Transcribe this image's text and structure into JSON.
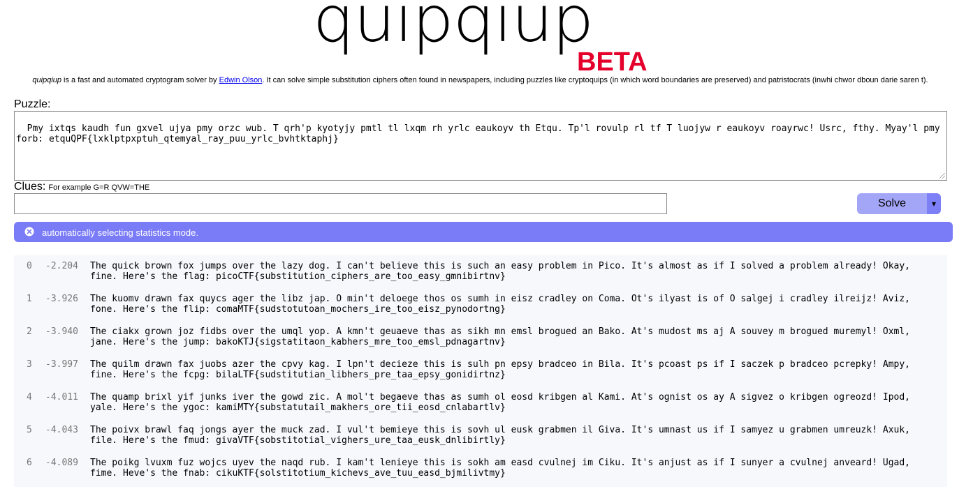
{
  "logo": {
    "word": "quipqiup",
    "badge": "BETA"
  },
  "tagline": {
    "name": "quipqiup",
    "part1": " is a fast and automated cryptogram solver by ",
    "author": "Edwin Olson",
    "part2": ". It can solve simple substitution ciphers often found in newspapers, including puzzles like cryptoquips (in which word boundaries are preserved) and patristocrats (inwhi chwor dboun darie saren t)."
  },
  "puzzle": {
    "label": "Puzzle:",
    "value": "Pmy ixtqs kaudh fun gxvel ujya pmy orzc wub. T qrh'p kyotyjy pmtl tl lxqm rh yrlc eaukoyv th Etqu. Tp'l rovulp rl tf T luojyw r eaukoyv roayrwc! Usrc, fthy. Myay'l pmy forb: etquQPF{lxklptpxptuh_qtemyal_ray_puu_yrlc_bvhtktaphj}"
  },
  "clues": {
    "label": "Clues:",
    "hint": "For example G=R QVW=THE",
    "value": ""
  },
  "solve": {
    "label": "Solve",
    "dropdown_glyph": "▾"
  },
  "alert": {
    "text": "automatically selecting statistics mode.",
    "icon": "close-circle-icon"
  },
  "results": [
    {
      "index": "0",
      "score": "-2.204",
      "text": "The quick brown fox jumps over the lazy dog. I can't believe this is such an easy problem in Pico. It's almost as if I solved a problem already! Okay, fine. Here's the flag: picoCTF{substitution_ciphers_are_too_easy_gmnibirtnv}"
    },
    {
      "index": "1",
      "score": "-3.926",
      "text": "The kuomv drawn fax quycs ager the libz jap. O min't deloege thos os sumh in eisz cradley on Coma. Ot's ilyast is of O salgej i cradley ilreijz! Aviz, fone. Here's the flip: comaMTF{sudstotutoan_mochers_ire_too_eisz_pynodortng}"
    },
    {
      "index": "2",
      "score": "-3.940",
      "text": "The ciakx grown joz fidbs over the umql yop. A kmn't geuaeve thas as sikh mn emsl brogued an Bako. At's mudost ms aj A souvey m brogued muremyl! Oxml, jane. Here's the jump: bakoKTJ{sigstatitaon_kabhers_mre_too_emsl_pdnagartnv}"
    },
    {
      "index": "3",
      "score": "-3.997",
      "text": "The quilm drawn fax juobs azer the cpvy kag. I lpn't decieze this is sulh pn epsy bradceo in Bila. It's pcoast ps if I saczek p bradceo pcrepky! Ampy, fine. Here's the fcpg: bilaLTF{sudstitutian_libhers_pre_taa_epsy_gonidirtnz}"
    },
    {
      "index": "4",
      "score": "-4.011",
      "text": "The quamp brixl yif junks iver the gowd zic. A mol't begaeve thas as sumh ol eosd kribgen al Kami. At's ognist os ay A sigvez o kribgen ogreozd! Ipod, yale. Here's the ygoc: kamiMTY{substatutail_makhers_ore_tii_eosd_cnlabartlv}"
    },
    {
      "index": "5",
      "score": "-4.043",
      "text": "The poivx brawl faq jongs ayer the muck zad. I vul't bemieye this is sovh ul eusk grabmen il Giva. It's umnast us if I samyez u grabmen umreuzk! Axuk, file. Here's the fmud: givaVTF{sobstitotial_vighers_ure_taa_eusk_dnlibirtly}"
    },
    {
      "index": "6",
      "score": "-4.089",
      "text": "The poikg lvuxm fuz wojcs uyev the naqd rub. I kam't lenieye this is sokh am easd cvulnej im Ciku. It's anjust as if I sunyer a cvulnej anveard! Ugad, fime. Heve's the fnab: cikuKTF{solstitotium_kichevs_ave_tuu_easd_bjmilivtmy}"
    }
  ]
}
